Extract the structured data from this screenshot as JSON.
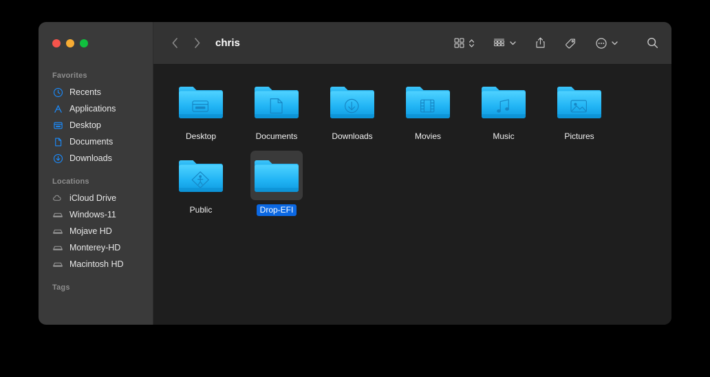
{
  "window": {
    "title": "chris",
    "traffic_lights": [
      {
        "name": "close",
        "color": "#f5544c"
      },
      {
        "name": "minimize",
        "color": "#f7ac34"
      },
      {
        "name": "zoom",
        "color": "#10bf3e"
      }
    ]
  },
  "toolbar": {
    "back_icon": "chevron-left-icon",
    "forward_icon": "chevron-right-icon",
    "title": "chris",
    "buttons": [
      {
        "name": "view-mode-icon-grid",
        "icon": "grid-view-icon",
        "has_chevron": true,
        "chevron": "chevron-up-down"
      },
      {
        "name": "group-by",
        "icon": "group-by-icon",
        "has_chevron": true,
        "chevron": "chevron-down"
      },
      {
        "name": "share",
        "icon": "share-icon",
        "has_chevron": false
      },
      {
        "name": "tag",
        "icon": "tag-icon",
        "has_chevron": false
      },
      {
        "name": "more-actions",
        "icon": "ellipsis-circle-icon",
        "has_chevron": true,
        "chevron": "chevron-down"
      },
      {
        "name": "search",
        "icon": "search-icon",
        "has_chevron": false
      }
    ]
  },
  "sidebar": {
    "groups": [
      {
        "header": "Favorites",
        "items": [
          {
            "label": "Recents",
            "icon": "clock-icon"
          },
          {
            "label": "Applications",
            "icon": "applications-a-icon"
          },
          {
            "label": "Desktop",
            "icon": "desktop-window-icon"
          },
          {
            "label": "Documents",
            "icon": "document-page-icon"
          },
          {
            "label": "Downloads",
            "icon": "download-arrow-icon"
          }
        ]
      },
      {
        "header": "Locations",
        "items": [
          {
            "label": "iCloud Drive",
            "icon": "cloud-icon"
          },
          {
            "label": "Windows-11",
            "icon": "hard-drive-icon"
          },
          {
            "label": "Mojave HD",
            "icon": "hard-drive-icon"
          },
          {
            "label": "Monterey-HD",
            "icon": "hard-drive-icon"
          },
          {
            "label": "Macintosh HD",
            "icon": "hard-drive-icon"
          }
        ]
      },
      {
        "header": "Tags",
        "items": []
      }
    ]
  },
  "content": {
    "items": [
      {
        "label": "Desktop",
        "glyph": "desktop",
        "selected": false
      },
      {
        "label": "Documents",
        "glyph": "document",
        "selected": false
      },
      {
        "label": "Downloads",
        "glyph": "download",
        "selected": false
      },
      {
        "label": "Movies",
        "glyph": "movies",
        "selected": false
      },
      {
        "label": "Music",
        "glyph": "music",
        "selected": false
      },
      {
        "label": "Pictures",
        "glyph": "pictures",
        "selected": false
      },
      {
        "label": "Public",
        "glyph": "public",
        "selected": false
      },
      {
        "label": "Drop-EFI",
        "glyph": "plain",
        "selected": true
      }
    ]
  },
  "colors": {
    "selection_blue": "#0b68e3",
    "sidebar_icon_blue": "#1a8cff",
    "folder_blue": "#22b5f5",
    "sidebar_bg": "#3a3a3a",
    "toolbar_bg": "#333333",
    "content_bg": "#1e1e1e"
  }
}
